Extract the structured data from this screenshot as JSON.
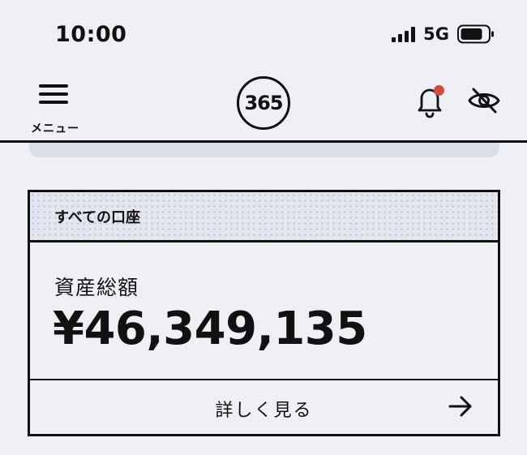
{
  "status_bar": {
    "time": "10:00",
    "network": "5G",
    "icons": [
      "signal-icon",
      "battery-icon"
    ]
  },
  "header": {
    "menu_label": "メニュー",
    "logo_text": "365",
    "notification_badge_color": "#d14b45",
    "icons": [
      "hamburger-menu-icon",
      "bell-icon",
      "eye-slash-icon"
    ]
  },
  "account_card": {
    "title": "すべての口座",
    "total_label": "資産総額",
    "total_value": "¥46,349,135",
    "detail_label": "詳しく見る",
    "icons": [
      "arrow-right-icon"
    ]
  },
  "colors": {
    "background": "#eef0f6",
    "text": "#111111",
    "accent_badge": "#d14b45"
  }
}
